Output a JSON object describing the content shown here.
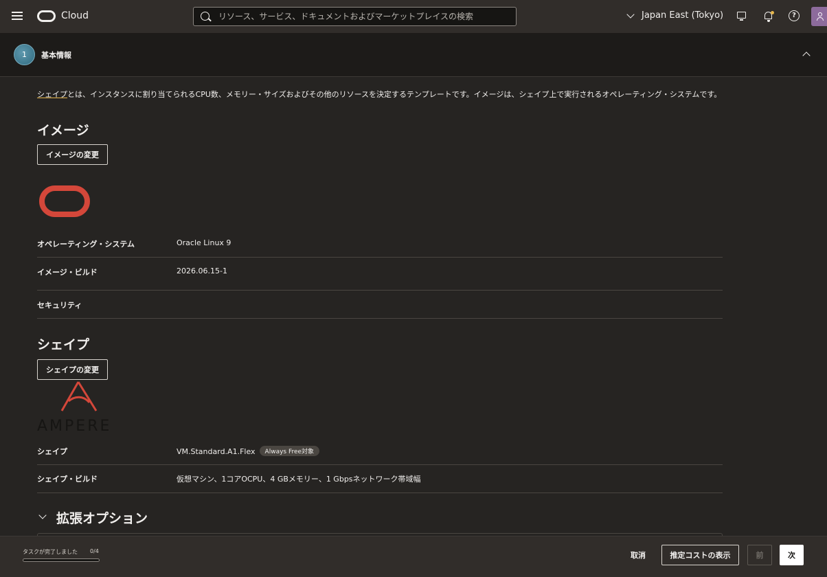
{
  "header": {
    "brand": "Cloud",
    "search_placeholder": "リソース、サービス、ドキュメントおよびマーケットプレイスの検索",
    "region": "Japan East (Tokyo)",
    "help_glyph": "?"
  },
  "section": {
    "step": "1",
    "title": "基本情報"
  },
  "intro": {
    "link": "シェイプ",
    "text": "とは、インスタンスに割り当てられるCPU数、メモリー・サイズおよびその他のリソースを決定するテンプレートです。イメージは、シェイプ上で実行されるオペレーティング・システムです。"
  },
  "image": {
    "heading": "イメージ",
    "change_button": "イメージの変更",
    "rows": [
      {
        "label": "オペレーティング・システム",
        "value": "Oracle Linux 9"
      },
      {
        "label": "イメージ・ビルド",
        "value": "2026.06.15-1"
      },
      {
        "label": "セキュリティ",
        "value": ""
      }
    ]
  },
  "shape": {
    "heading": "シェイプ",
    "change_button": "シェイプの変更",
    "vendor_logo_text": "AMPERE",
    "rows": [
      {
        "label": "シェイプ",
        "value": "VM.Standard.A1.Flex",
        "badge": "Always Free対象"
      },
      {
        "label": "シェイプ・ビルド",
        "value": "仮想マシン、1コアOCPU、4 GBメモリー、1 Gbpsネットワーク帯域幅"
      }
    ]
  },
  "advanced": {
    "heading": "拡張オプション"
  },
  "footer": {
    "progress_label": "タスクが完了しました",
    "progress_count": "0/4",
    "progress_fraction": 0,
    "cancel": "取消",
    "show_cost": "推定コストの表示",
    "prev": "前",
    "next": "次"
  },
  "colors": {
    "accent_link_underline": "#e6b64b",
    "oracle_red": "#d4473a",
    "primary_button": "#ffffff"
  }
}
